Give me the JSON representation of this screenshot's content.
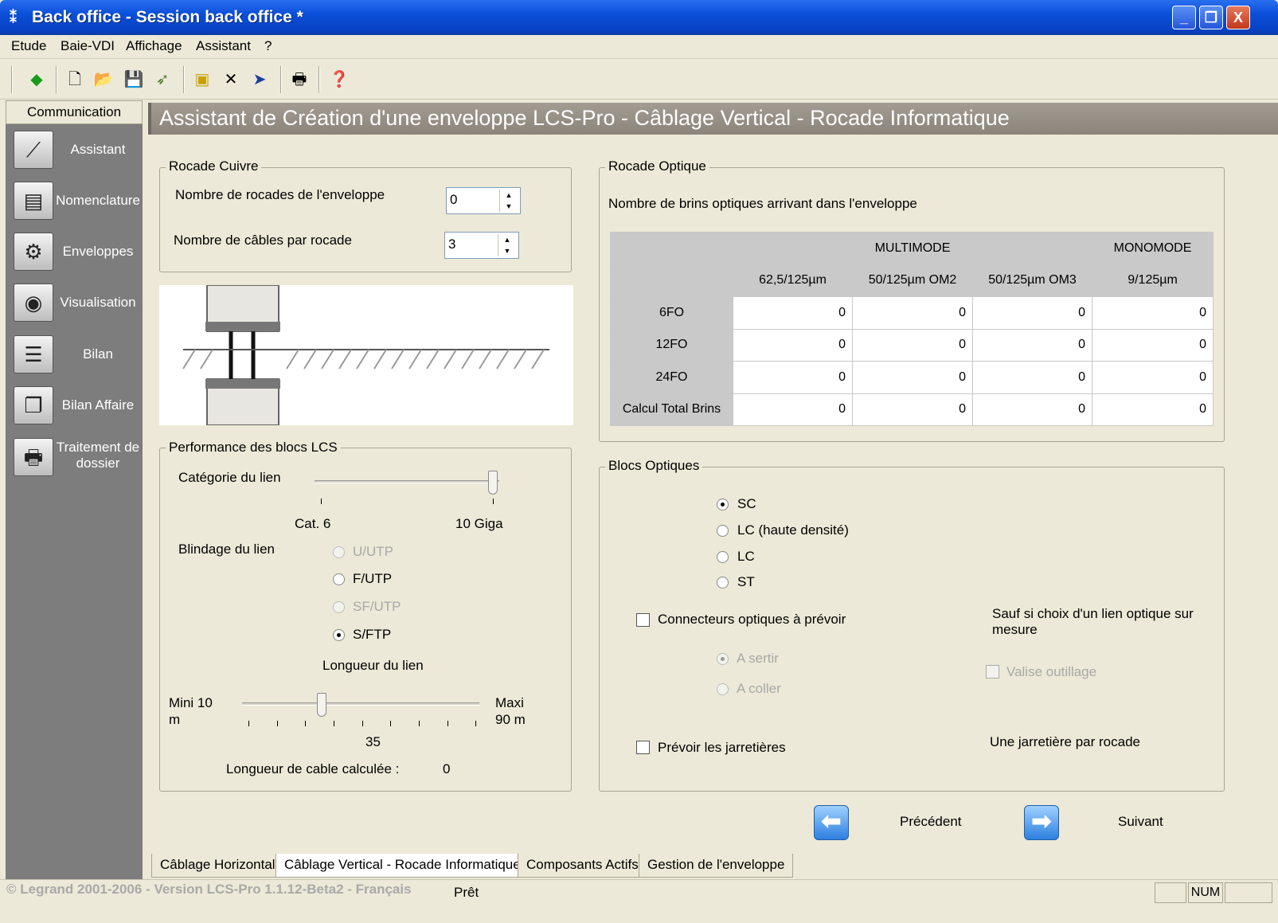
{
  "window": {
    "title": "Back office - Session back office *",
    "icon": "app-icon",
    "min": "_",
    "max": "❐",
    "close": "X"
  },
  "menu": [
    "Etude",
    "Baie-VDI",
    "Affichage",
    "Assistant",
    "?"
  ],
  "sidebar": {
    "header": "Communication",
    "items": [
      {
        "label": "Assistant",
        "icon": "wand-icon"
      },
      {
        "label": "Nomenclature",
        "icon": "rack-icon"
      },
      {
        "label": "Enveloppes",
        "icon": "gears-icon"
      },
      {
        "label": "Visualisation",
        "icon": "eye-icon"
      },
      {
        "label": "Bilan",
        "icon": "report-icon"
      },
      {
        "label": "Bilan Affaire",
        "icon": "documents-icon"
      },
      {
        "label": "Traitement de dossier",
        "icon": "printer-icon"
      }
    ]
  },
  "banner": "Assistant de Création d'une enveloppe LCS-Pro - Câblage Vertical - Rocade Informatique",
  "cuivre": {
    "legend": "Rocade Cuivre",
    "rocades_label": "Nombre de rocades de l'enveloppe",
    "rocades_value": "0",
    "cables_label": "Nombre de câbles par rocade",
    "cables_value": "3"
  },
  "performance": {
    "legend": "Performance des blocs LCS",
    "categorie_label": "Catégorie du lien",
    "categorie_min": "Cat. 6",
    "categorie_max": "10 Giga",
    "categorie_selected": "10 Giga",
    "blindage_label": "Blindage du lien",
    "blindage_options": [
      {
        "label": "U/UTP",
        "enabled": false,
        "checked": false
      },
      {
        "label": "F/UTP",
        "enabled": true,
        "checked": false
      },
      {
        "label": "SF/UTP",
        "enabled": false,
        "checked": false
      },
      {
        "label": "S/FTP",
        "enabled": true,
        "checked": true
      }
    ],
    "longueur_label": "Longueur du lien",
    "longueur_min_label": "Mini 10 m",
    "longueur_min_line1": "Mini 10",
    "longueur_min_line2": "m",
    "longueur_max_line1": "Maxi",
    "longueur_max_line2": "90 m",
    "longueur_value": "35",
    "cable_calc_label": "Longueur de cable calculée :",
    "cable_calc_value": "0"
  },
  "optique": {
    "legend": "Rocade Optique",
    "subtitle": "Nombre de brins optiques arrivant dans l'enveloppe",
    "group_headers": {
      "multimode": "MULTIMODE",
      "monomode": "MONOMODE"
    },
    "columns": [
      "62,5/125µm",
      "50/125µm OM2",
      "50/125µm OM3",
      "9/125µm"
    ],
    "rows": [
      {
        "label": "6FO",
        "values": [
          "0",
          "0",
          "0",
          "0"
        ]
      },
      {
        "label": "12FO",
        "values": [
          "0",
          "0",
          "0",
          "0"
        ]
      },
      {
        "label": "24FO",
        "values": [
          "0",
          "0",
          "0",
          "0"
        ]
      },
      {
        "label": "Calcul Total Brins",
        "values": [
          "0",
          "0",
          "0",
          "0"
        ]
      }
    ]
  },
  "blocs": {
    "legend": "Blocs Optiques",
    "types": [
      {
        "label": "SC",
        "checked": true
      },
      {
        "label": "LC (haute densité)",
        "checked": false
      },
      {
        "label": "LC",
        "checked": false
      },
      {
        "label": "ST",
        "checked": false
      }
    ],
    "connecteurs_label": "Connecteurs optiques à prévoir",
    "sauf_note": "Sauf si choix d'un lien optique sur mesure",
    "sertir_label": "A sertir",
    "coller_label": "A coller",
    "valise_label": "Valise outillage",
    "jarretieres_label": "Prévoir les jarretières",
    "jarretiere_note": "Une jarretière par rocade"
  },
  "nav": {
    "prev": "Précédent",
    "next": "Suivant"
  },
  "tabs": [
    {
      "label": "Câblage Horizontal",
      "active": false
    },
    {
      "label": "Câblage Vertical - Rocade Informatique",
      "active": true
    },
    {
      "label": "Composants Actifs",
      "active": false
    },
    {
      "label": "Gestion de l'enveloppe",
      "active": false
    }
  ],
  "status": {
    "copyright": "© Legrand 2001-2006 - Version LCS-Pro 1.1.12-Beta2 - Français",
    "text": "Prêt",
    "num": "NUM"
  }
}
